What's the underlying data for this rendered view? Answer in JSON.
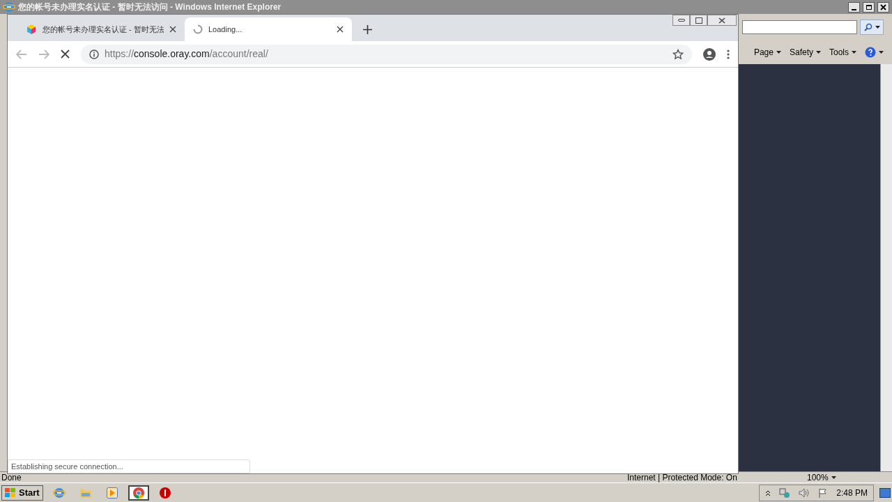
{
  "ie_window": {
    "title": "您的帐号未办理实名认证 - 暂时无法访问 - Windows Internet Explorer",
    "commands": [
      "Page",
      "Safety",
      "Tools"
    ],
    "status_bar": {
      "text": "Done",
      "zone": "Internet | Protected Mode: On",
      "zoom": "100%"
    }
  },
  "chrome_window": {
    "tabs": [
      {
        "title": "您的帐号未办理实名认证 - 暂时无法",
        "selected": false,
        "loading": false
      },
      {
        "title": "Loading...",
        "selected": true,
        "loading": true
      }
    ],
    "address": {
      "scheme": "https://",
      "host": "console.oray.com",
      "path": "/account/real/"
    },
    "status": "Establishing secure connection..."
  },
  "taskbar": {
    "start": "Start",
    "apps": [
      {
        "kind": "ie",
        "selected": false
      },
      {
        "kind": "folder",
        "selected": false
      },
      {
        "kind": "media",
        "selected": false
      },
      {
        "kind": "chrome",
        "selected": true
      },
      {
        "kind": "stop",
        "selected": false
      }
    ],
    "clock": "2:48 PM"
  }
}
